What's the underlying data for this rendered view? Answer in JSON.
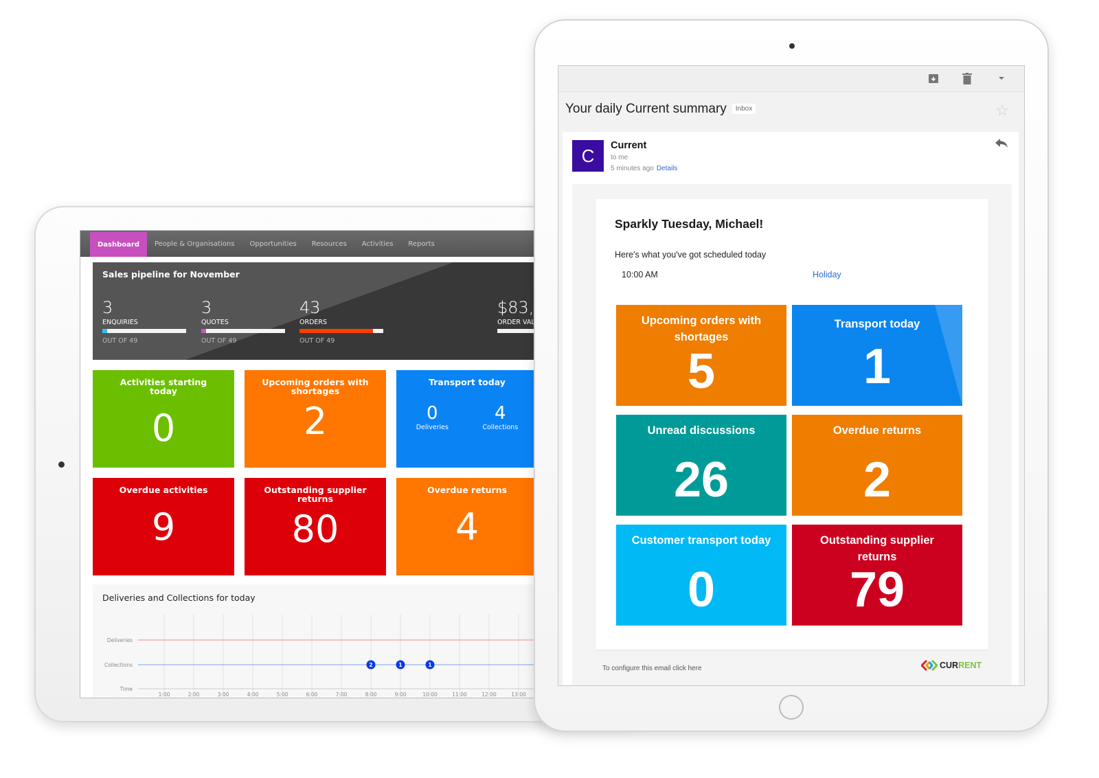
{
  "crm": {
    "nav": [
      {
        "label": "Dashboard",
        "active": true
      },
      {
        "label": "People & Organisations"
      },
      {
        "label": "Opportunities"
      },
      {
        "label": "Resources"
      },
      {
        "label": "Activities"
      },
      {
        "label": "Reports"
      }
    ],
    "pipeline": {
      "title": "Sales pipeline for November",
      "metrics": [
        {
          "value": "3",
          "label": "ENQUIRIES",
          "out_of": "OUT OF 49",
          "fraction": 0.061,
          "color": "#29c5f6"
        },
        {
          "value": "3",
          "label": "QUOTES",
          "out_of": "OUT OF 49",
          "fraction": 0.061,
          "color": "#c05bb8"
        },
        {
          "value": "43",
          "label": "ORDERS",
          "out_of": "OUT OF 49",
          "fraction": 0.878,
          "color": "#ff3d00"
        },
        {
          "value": "$83,",
          "label": "ORDER VAL",
          "out_of": "",
          "fraction": 0,
          "color": "#ffffff"
        }
      ]
    },
    "tiles": [
      {
        "title": "Activities starting today",
        "value": "0",
        "color": "#6cbf00"
      },
      {
        "title": "Upcoming orders with shortages",
        "value": "2",
        "color": "#ff7600"
      },
      {
        "title": "Transport today",
        "value": "",
        "color": "#0a84f5",
        "split": [
          {
            "value": "0",
            "label": "Deliveries"
          },
          {
            "value": "4",
            "label": "Collections"
          }
        ]
      },
      {
        "title": "Overdue activities",
        "value": "9",
        "color": "#de0009"
      },
      {
        "title": "Outstanding supplier returns",
        "value": "80",
        "color": "#de0009"
      },
      {
        "title": "Overdue returns",
        "value": "4",
        "color": "#ff7600"
      }
    ],
    "chart_data": {
      "type": "scatter",
      "title": "Deliveries and Collections for today",
      "rows": [
        "Deliveries",
        "Collections"
      ],
      "ylabel_axis": "Time",
      "x_ticks": [
        "1:00",
        "2:00",
        "3:00",
        "4:00",
        "5:00",
        "6:00",
        "7:00",
        "8:00",
        "9:00",
        "10:00",
        "11:00",
        "12:00",
        "13:00"
      ],
      "series": [
        {
          "name": "Deliveries",
          "color": "#f08a8a",
          "points": []
        },
        {
          "name": "Collections",
          "color": "#7aa4ef",
          "points": [
            {
              "x": "8:00",
              "count": 2
            },
            {
              "x": "9:00",
              "count": 1
            },
            {
              "x": "10:00",
              "count": 1
            }
          ]
        }
      ]
    }
  },
  "email": {
    "subject": "Your daily Current summary",
    "badge": "Inbox",
    "sender": "Current",
    "avatar_letter": "C",
    "to": "to me",
    "when": "5 minutes ago",
    "details": "Details",
    "greeting": "Sparkly Tuesday, Michael!",
    "schedule_intro": "Here's what you've got scheduled today",
    "schedule": [
      {
        "time": "10:00 AM",
        "event": "Holiday"
      }
    ],
    "tiles": [
      {
        "title": "Upcoming orders with shortages",
        "value": "5",
        "color": "#ef7d00"
      },
      {
        "title": "Transport today",
        "value": "1",
        "color": "#0a86ee"
      },
      {
        "title": "Unread discussions",
        "value": "26",
        "color": "#009b98"
      },
      {
        "title": "Overdue returns",
        "value": "2",
        "color": "#ef7d00"
      },
      {
        "title": "Customer transport today",
        "value": "0",
        "color": "#00b9f5"
      },
      {
        "title": "Outstanding supplier returns",
        "value": "79",
        "color": "#cc001f"
      }
    ],
    "footer": "To configure this email click here",
    "logo": {
      "part1": "CUR",
      "part2": "RENT"
    }
  }
}
